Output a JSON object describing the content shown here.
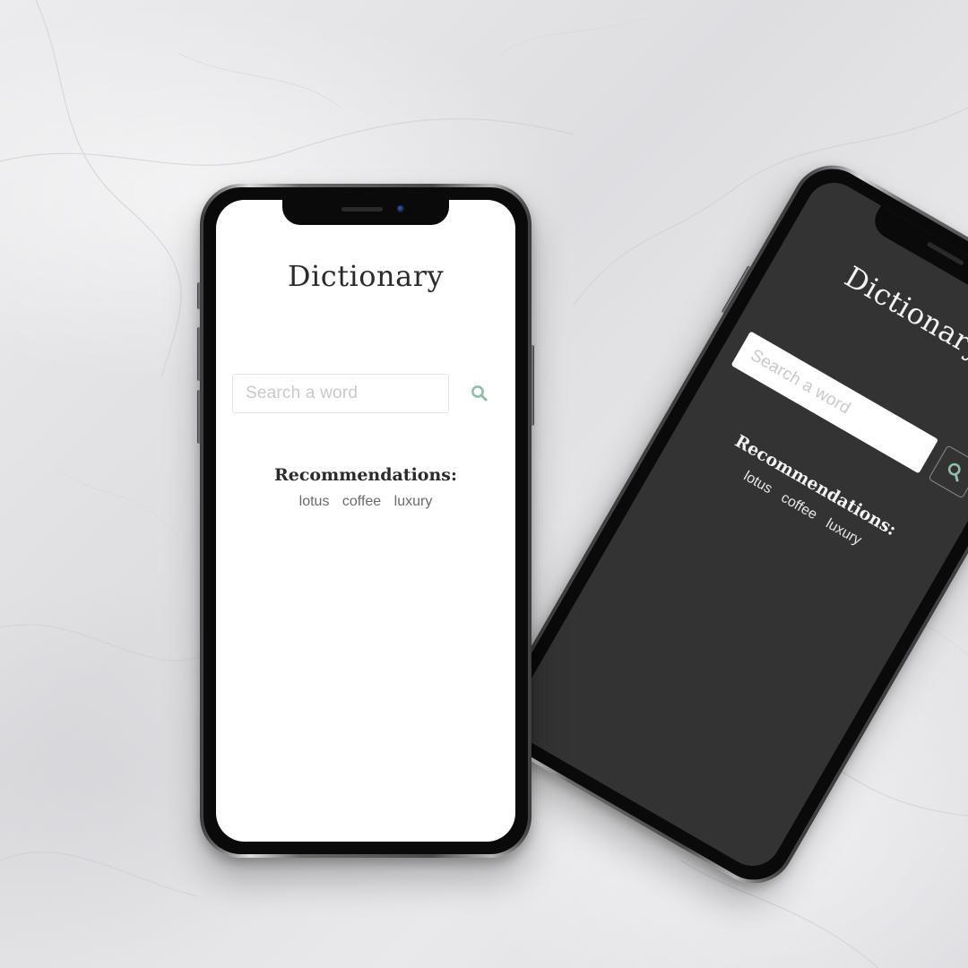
{
  "colors": {
    "accent": "#8fbfa8",
    "light_screen": "#ffffff",
    "dark_screen": "#333333"
  },
  "light_phone": {
    "title": "Dictionary",
    "search": {
      "placeholder": "Search a word",
      "icon": "search-icon"
    },
    "recommendations": {
      "title": "Recommendations:",
      "items": [
        "lotus",
        "coffee",
        "luxury"
      ]
    }
  },
  "dark_phone": {
    "title": "Dictionary",
    "search": {
      "placeholder": "Search a word",
      "icon": "search-icon"
    },
    "recommendations": {
      "title": "Recommendations:",
      "items": [
        "lotus",
        "coffee",
        "luxury"
      ]
    }
  }
}
